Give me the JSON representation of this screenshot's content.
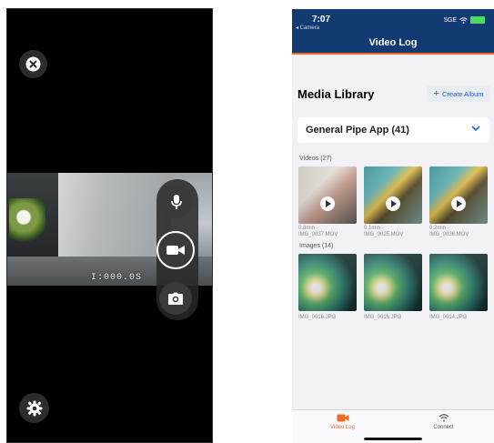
{
  "camera": {
    "timestamp": "I:000.0S",
    "icons": {
      "close": "close-icon",
      "mic": "microphone-icon",
      "record": "video-camera-icon",
      "photo": "camera-icon",
      "settings": "gear-icon"
    },
    "recording_active": false
  },
  "status_bar": {
    "time": "7:07",
    "back_label": "◂ Camera",
    "network": "5GE"
  },
  "nav": {
    "title": "Video Log"
  },
  "library": {
    "title": "Media Library",
    "create_album_label": "Create Album",
    "selected_album": "General Pipe App (41)",
    "videos_header": "Videos (27)",
    "images_header": "Images (14)",
    "videos": [
      {
        "duration": "0.8min -",
        "name": "IMG_0037.MOV"
      },
      {
        "duration": "0.1min -",
        "name": "IMG_0025.MOV"
      },
      {
        "duration": "0.2min -",
        "name": "IMG_0036.MOV"
      }
    ],
    "images": [
      {
        "name": "IMG_0016.JPG"
      },
      {
        "name": "IMG_0015.JPG"
      },
      {
        "name": "IMG_0014.JPG"
      }
    ]
  },
  "tabbar": {
    "tabs": [
      {
        "label": "Video Log",
        "active": true
      },
      {
        "label": "Connect",
        "active": false
      }
    ]
  },
  "colors": {
    "accent": "#f26a21",
    "nav": "#123a73",
    "link": "#1e63d4"
  }
}
